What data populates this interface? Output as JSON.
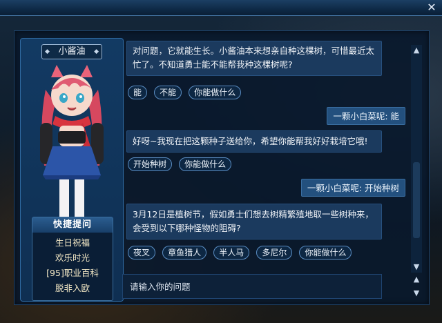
{
  "window": {
    "close_label": "✕"
  },
  "character": {
    "name": "小酱油"
  },
  "quick_questions": {
    "title": "快捷提问",
    "items": [
      "生日祝福",
      "欢乐时光",
      "[95]职业百科",
      "脱非入欧"
    ]
  },
  "chat": {
    "messages": [
      {
        "type": "npc",
        "text": "对问题，它就能生长。小酱油本来想亲自种这棵树，可惜最近太忙了。不知道勇士能不能帮我种这棵树呢?"
      },
      {
        "type": "options",
        "options": [
          "能",
          "不能",
          "你能做什么"
        ]
      },
      {
        "type": "user",
        "text": "一颗小白菜呢: 能"
      },
      {
        "type": "npc",
        "text": "好呀~我现在把这颗种子送给你，希望你能帮我好好栽培它哦!"
      },
      {
        "type": "options",
        "options": [
          "开始种树",
          "你能做什么"
        ]
      },
      {
        "type": "user",
        "text": "一颗小白菜呢: 开始种树"
      },
      {
        "type": "npc",
        "text": "3月12日是植树节，假如勇士们想去树精繁殖地取一些树种来，会受到以下哪种怪物的阻碍?"
      },
      {
        "type": "options",
        "options": [
          "夜叉",
          "章鱼猎人",
          "半人马",
          "多尼尔",
          "你能做什么"
        ]
      }
    ]
  },
  "input": {
    "placeholder": "请输入你的问题"
  },
  "colors": {
    "accent": "#5b8ec4",
    "panel": "#123a63",
    "bubble": "#1b3a5e"
  }
}
